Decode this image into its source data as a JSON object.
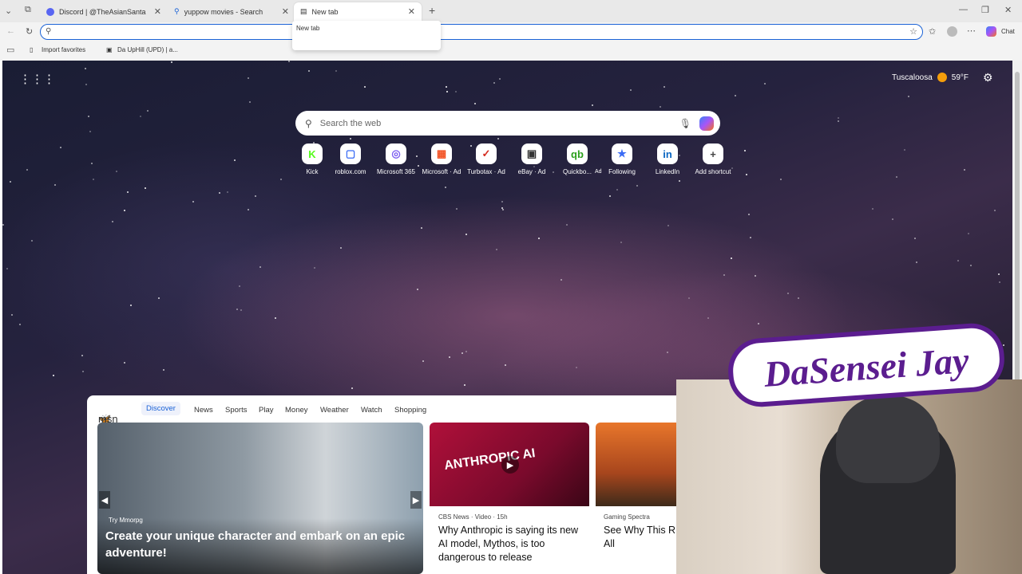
{
  "browser": {
    "tabs": [
      {
        "title": "Discord | @TheAsianSanta",
        "icon": "discord-icon"
      },
      {
        "title": "yuppow movies - Search",
        "icon": "search-icon"
      },
      {
        "title": "New tab",
        "icon": "page-icon"
      }
    ],
    "tooltip": "New tab",
    "address_value": "",
    "chat_label": "Chat",
    "bookmarks": [
      "Import favorites",
      "Da UpHill (UPD) | a..."
    ]
  },
  "page": {
    "weather": {
      "city": "Tuscaloosa",
      "temp": "59°F"
    },
    "search_placeholder": "Search the web",
    "shortcuts": [
      {
        "label": "Kick",
        "icon": "kick-icon",
        "glyph": "K",
        "color": "#53fc18"
      },
      {
        "label": "roblox.com",
        "icon": "roblox-icon",
        "glyph": "▢",
        "color": "#3b6cf5"
      },
      {
        "label": "Microsoft 365",
        "icon": "microsoft-365-icon",
        "glyph": "◎",
        "color": "#7b5cf0"
      },
      {
        "label": "Microsoft · Ad",
        "icon": "microsoft-icon",
        "glyph": "▦",
        "color": "#f25022"
      },
      {
        "label": "Turbotax · Ad",
        "icon": "turbotax-icon",
        "glyph": "✓",
        "color": "#d52b1e"
      },
      {
        "label": "eBay · Ad",
        "icon": "shopping-bag-icon",
        "glyph": "▣",
        "color": "#333333"
      },
      {
        "label": "Quickbo...",
        "ad": "Ad",
        "icon": "quickbooks-icon",
        "glyph": "qb",
        "color": "#2ca01c"
      },
      {
        "label": "Following",
        "icon": "following-icon",
        "glyph": "★",
        "color": "#3b6cf5"
      },
      {
        "label": "LinkedIn",
        "icon": "linkedin-icon",
        "glyph": "in",
        "color": "#0a66c2"
      },
      {
        "label": "Add shortcut",
        "icon": "plus-icon",
        "glyph": "+",
        "color": "#444444"
      }
    ],
    "msn": {
      "brand": "msn",
      "nav": [
        "Discover",
        "News",
        "Sports",
        "Play",
        "Money",
        "Weather",
        "Watch",
        "Shopping"
      ],
      "active": "Discover",
      "cards": [
        {
          "source": "Try Mmorpg",
          "title": "Create your unique character and embark on an epic adventure!"
        },
        {
          "source": "CBS News · Video · 15h",
          "title": "Why Anthropic is saying its new AI model, Mythos, is too dangerous to release",
          "overlay": "ANTHROPIC AI"
        },
        {
          "source": "Gaming Spectra",
          "title": "See Why This R of All"
        }
      ]
    }
  },
  "overlay": {
    "streamer_logo": "DaSensei Jay"
  }
}
